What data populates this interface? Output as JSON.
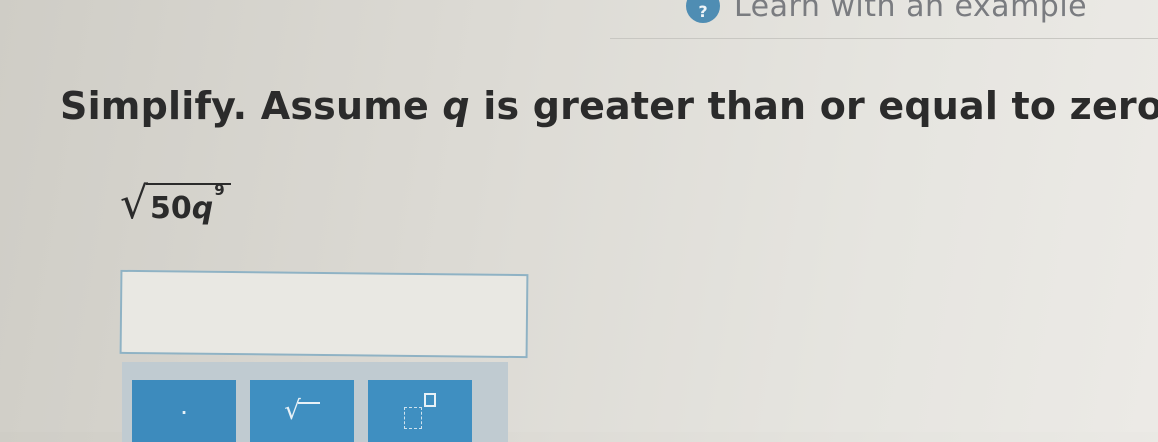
{
  "header": {
    "help_icon_glyph": "?",
    "learn_link": "Learn with an example"
  },
  "problem": {
    "prompt_before": "Simplify. Assume ",
    "prompt_var": "q",
    "prompt_after": " is greater than or equal to zero.",
    "expression": {
      "radical": "√",
      "coefficient": "50",
      "base": "q",
      "exponent": "9"
    }
  },
  "answer": {
    "value": ""
  },
  "toolbar": {
    "dot_label": "·",
    "sqrt_label": "√",
    "exponent_label": ""
  }
}
